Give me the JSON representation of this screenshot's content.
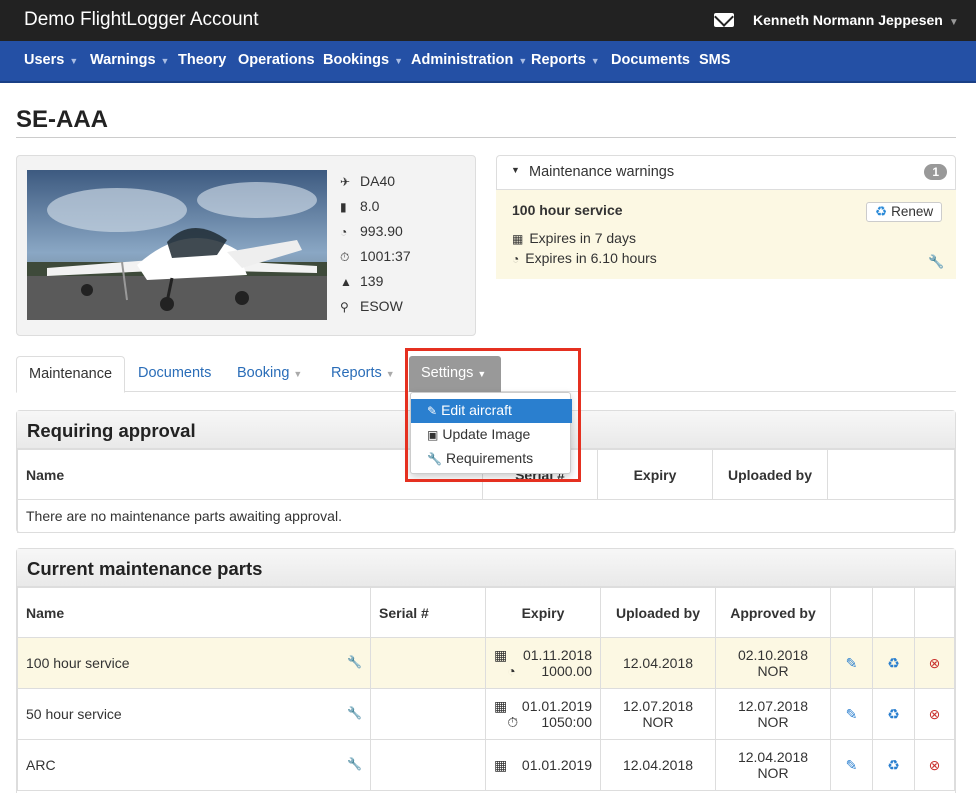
{
  "app": {
    "title": "Demo FlightLogger Account",
    "user": "Kenneth Normann Jeppesen"
  },
  "nav": [
    {
      "label": "Users",
      "caret": true
    },
    {
      "label": "Warnings",
      "caret": true
    },
    {
      "label": "Theory",
      "caret": false
    },
    {
      "label": "Operations",
      "caret": false
    },
    {
      "label": "Bookings",
      "caret": true
    },
    {
      "label": "Administration",
      "caret": true
    },
    {
      "label": "Reports",
      "caret": true
    },
    {
      "label": "Documents",
      "caret": false
    },
    {
      "label": "SMS",
      "caret": false
    }
  ],
  "page": {
    "title": "SE-AAA"
  },
  "aircraft": {
    "specs": [
      {
        "icon": "plane-icon",
        "value": "DA40"
      },
      {
        "icon": "fuel-icon",
        "value": "8.0"
      },
      {
        "icon": "speedometer-icon",
        "value": "993.90"
      },
      {
        "icon": "stopwatch-icon",
        "value": "1001:37"
      },
      {
        "icon": "road-icon",
        "value": "139"
      },
      {
        "icon": "map-marker-icon",
        "value": "ESOW"
      }
    ]
  },
  "maintenance_warnings": {
    "label": "Maintenance warnings",
    "count": "1",
    "service": "100 hour service",
    "renew": "Renew",
    "expires_days": "Expires in 7 days",
    "expires_hours": "Expires in 6.10 hours"
  },
  "tabs": [
    {
      "label": "Maintenance"
    },
    {
      "label": "Documents"
    },
    {
      "label": "Booking"
    },
    {
      "label": "Reports"
    },
    {
      "label": "Settings"
    }
  ],
  "settings_menu": [
    {
      "label": "Edit aircraft",
      "icon": "pencil-icon"
    },
    {
      "label": "Update Image",
      "icon": "image-icon"
    },
    {
      "label": "Requirements",
      "icon": "wrench-icon"
    }
  ],
  "requiring_approval": {
    "title": "Requiring approval",
    "columns": [
      "Name",
      "Serial #",
      "Expiry",
      "Uploaded by"
    ],
    "empty": "There are no maintenance parts awaiting approval."
  },
  "current_parts": {
    "title": "Current maintenance parts",
    "columns": [
      "Name",
      "Serial #",
      "Expiry",
      "Uploaded by",
      "Approved by"
    ],
    "rows": [
      {
        "name": "100 hour service",
        "serial": "",
        "expiry_date": "01.11.2018",
        "expiry_value": "1000.00",
        "expiry_value_icon": "speedometer-icon",
        "uploaded": "12.04.2018",
        "uploaded_by": "",
        "approved": "02.10.2018",
        "approved_by": "NOR"
      },
      {
        "name": "50 hour service",
        "serial": "",
        "expiry_date": "01.01.2019",
        "expiry_value": "1050:00",
        "expiry_value_icon": "stopwatch-icon",
        "uploaded": "12.07.2018",
        "uploaded_by": "NOR",
        "approved": "12.07.2018",
        "approved_by": "NOR"
      },
      {
        "name": "ARC",
        "serial": "",
        "expiry_date": "01.01.2019",
        "expiry_value": "",
        "expiry_value_icon": "",
        "uploaded": "12.04.2018",
        "uploaded_by": "",
        "approved": "12.04.2018",
        "approved_by": "NOR"
      }
    ]
  }
}
